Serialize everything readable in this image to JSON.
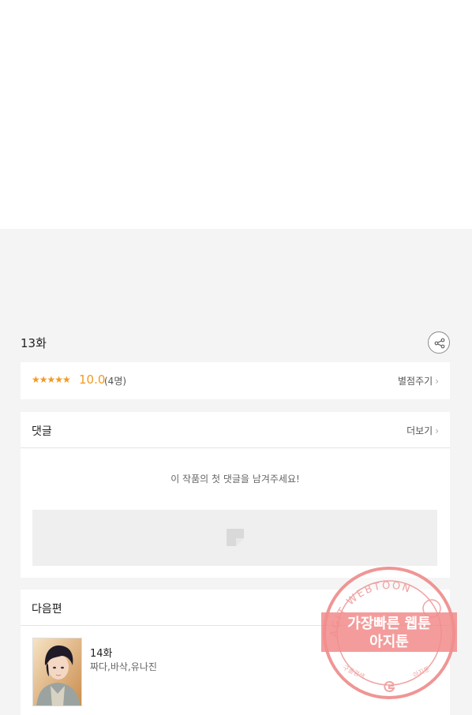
{
  "episode": {
    "title": "13화"
  },
  "rating": {
    "stars": "★★★★★",
    "score": "10.0",
    "count": "(4명)",
    "rate_label": "별점주기"
  },
  "comments": {
    "title": "댓글",
    "more_label": "더보기",
    "empty_message": "이 작품의 첫 댓글을 남겨주세요!"
  },
  "next": {
    "title": "다음편",
    "episode_title": "14화",
    "authors": "짜다,바삭,유나진"
  },
  "watermark": {
    "ring_text": "AGIT WEBTOON",
    "line1": "가장빠른 웹툰",
    "line2": "아지툰",
    "bottom_left": "구글검색",
    "bottom_right": "아지툰"
  },
  "icons": {
    "share": "share-icon",
    "chevron": "chevron-right-icon",
    "placeholder": "image-placeholder-icon"
  },
  "colors": {
    "rating_accent": "#f29a1f",
    "background_gray": "#f4f4f4",
    "watermark_red": "#ef6f6f"
  }
}
